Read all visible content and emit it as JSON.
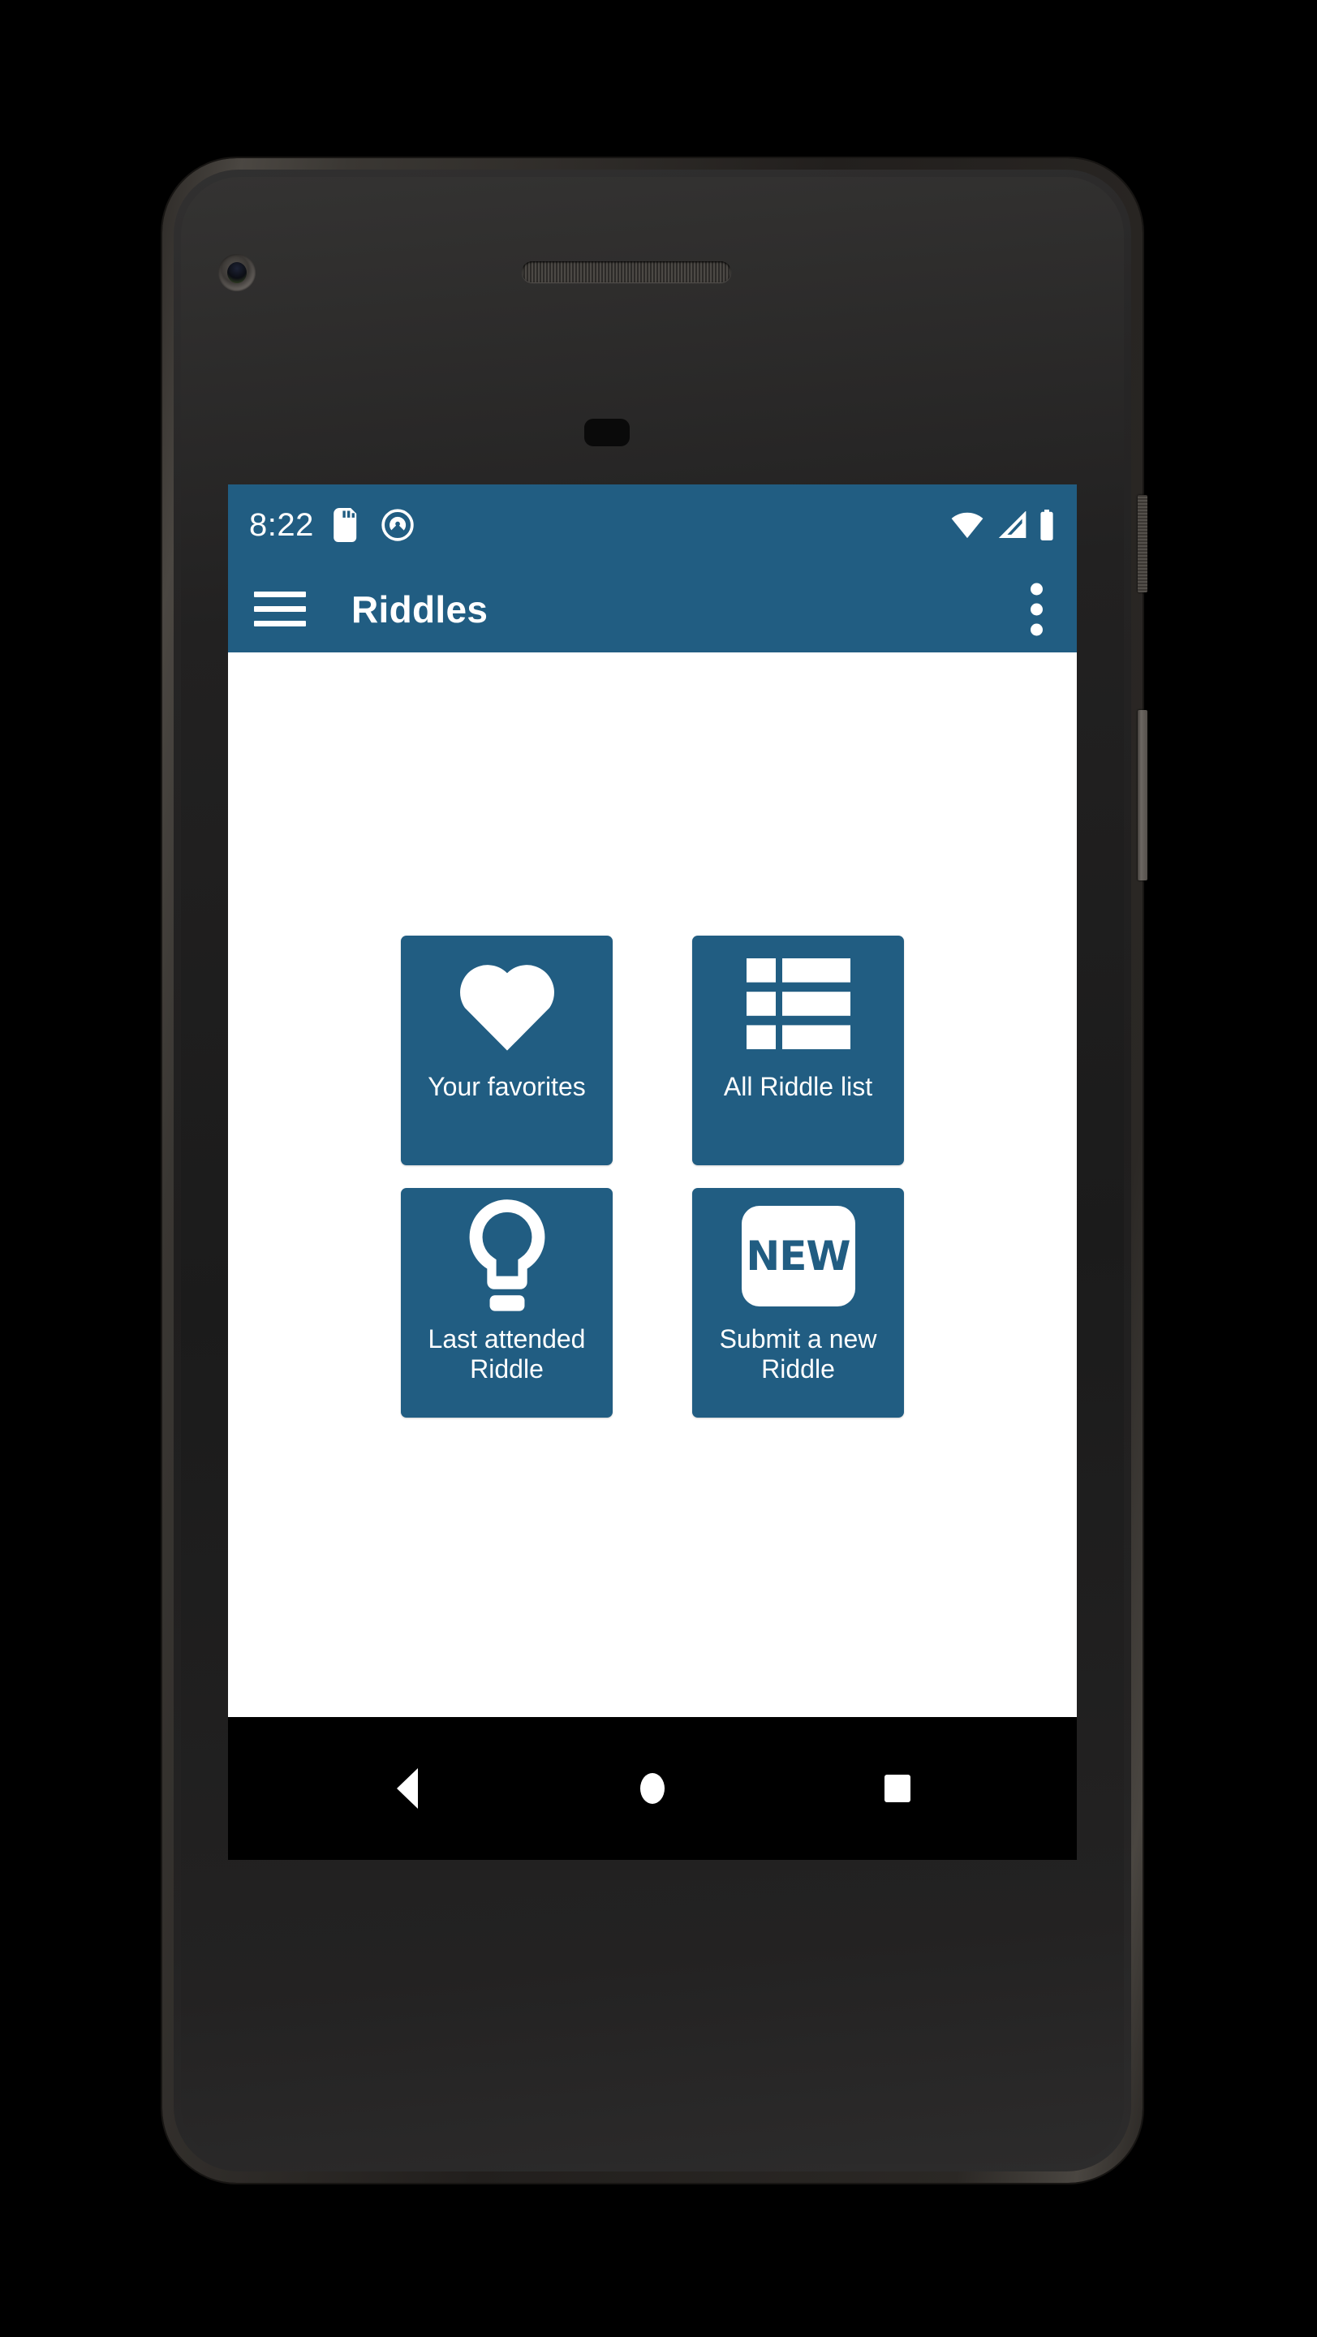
{
  "status_bar": {
    "time": "8:22",
    "left_icons": [
      "sd-card-icon",
      "do-not-disturb-icon"
    ],
    "right_icons": [
      "wifi-icon",
      "cell-signal-icon",
      "battery-icon"
    ],
    "background_color": "#215d82",
    "foreground_color": "#ffffff"
  },
  "app_bar": {
    "menu_icon": "hamburger-menu-icon",
    "title": "Riddles",
    "overflow_icon": "more-vert-icon",
    "background_color": "#215d82"
  },
  "content": {
    "background_color": "#ffffff",
    "tiles": [
      {
        "id": "favorites",
        "icon": "heart-icon",
        "label": "Your favorites"
      },
      {
        "id": "all-riddle-list",
        "icon": "list-icon",
        "label": "All Riddle list"
      },
      {
        "id": "last-attended",
        "icon": "lightbulb-icon",
        "label": "Last attended\nRiddle"
      },
      {
        "id": "submit-new",
        "icon": "new-badge-icon",
        "label": "Submit a new\nRiddle",
        "badge_text": "NEW"
      }
    ],
    "tile_color": "#215d82",
    "tile_text_color": "#ffffff"
  },
  "nav_bar": {
    "background_color": "#000000",
    "buttons": [
      "back-icon",
      "home-icon",
      "recents-icon"
    ]
  },
  "device": {
    "hardware": [
      "front-camera",
      "earpiece-speaker",
      "proximity-sensor",
      "power-button",
      "volume-button"
    ]
  }
}
